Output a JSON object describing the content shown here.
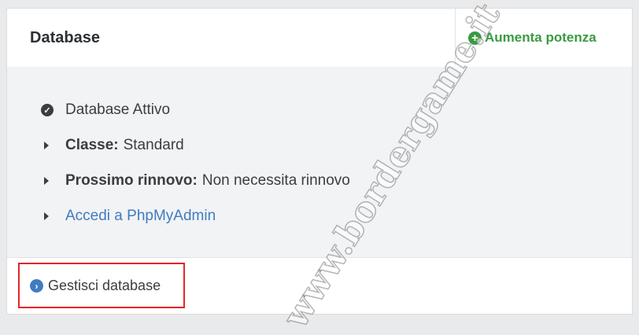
{
  "card": {
    "title": "Database",
    "upgrade_label": "Aumenta potenza",
    "upgrade_icon": "plus-circle-icon"
  },
  "details": {
    "status": {
      "icon": "check-circle-icon",
      "text": "Database Attivo"
    },
    "classe": {
      "label": "Classe:",
      "value": "Standard"
    },
    "rinnovo": {
      "label": "Prossimo rinnovo:",
      "value": "Non necessita rinnovo"
    },
    "phpmyadmin_link": "Accedi a PhpMyAdmin"
  },
  "footer": {
    "manage_label": "Gestisci database",
    "manage_icon": "chevron-circle-right-icon"
  },
  "watermark": "www.bordergame.it",
  "colors": {
    "accent_green": "#3a9a44",
    "link_blue": "#3f7cc0",
    "highlight_red": "#e2262a"
  }
}
